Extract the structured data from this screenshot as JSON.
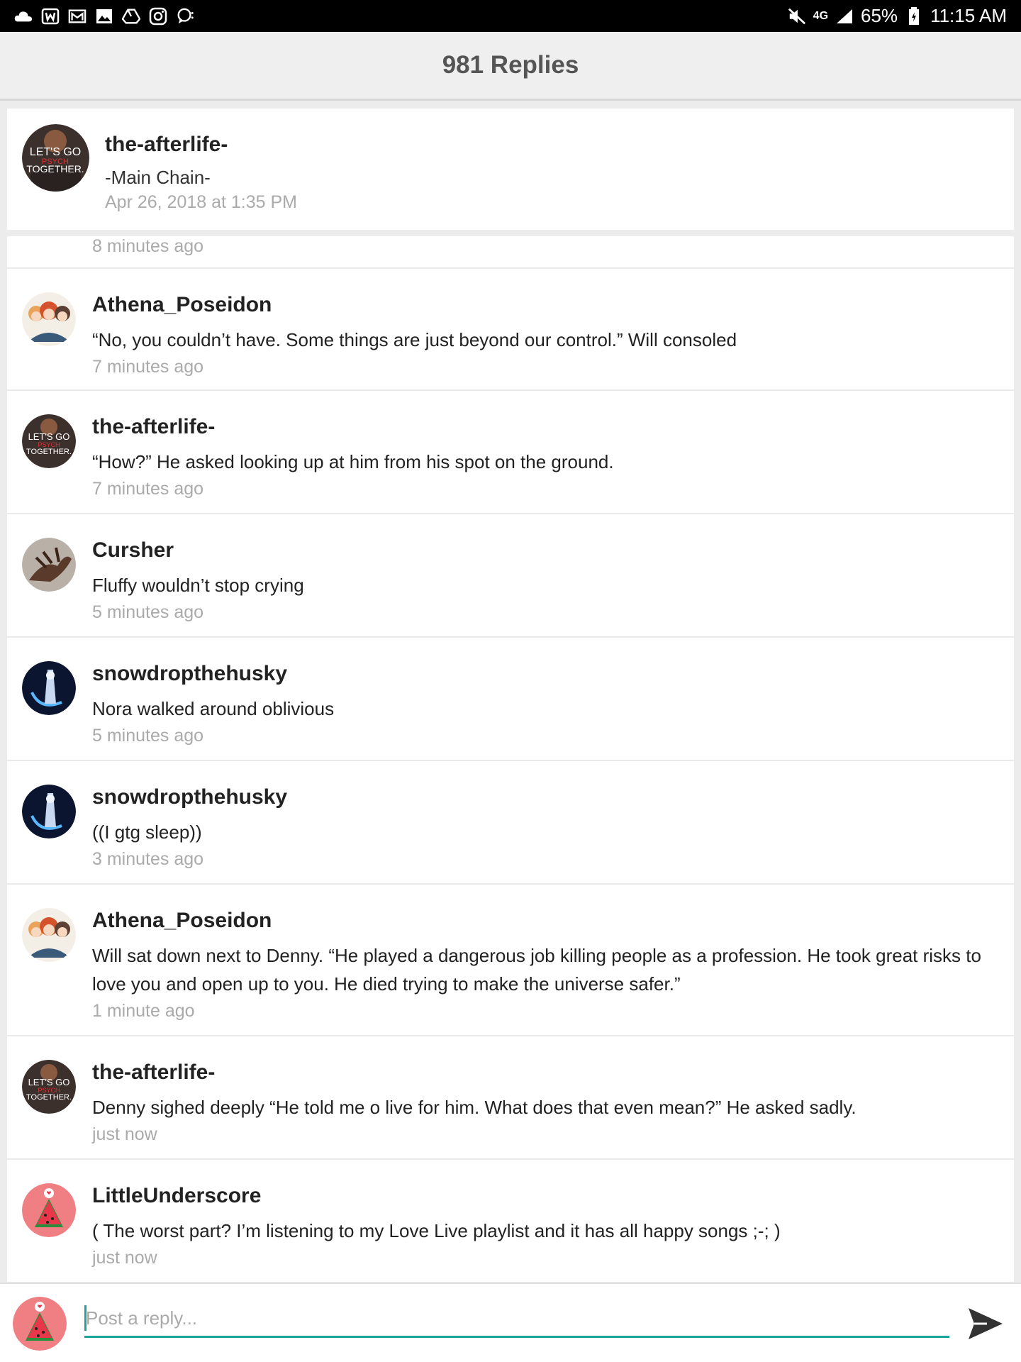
{
  "status_bar": {
    "left_icons": [
      "cloud-icon",
      "wattpad-icon",
      "mail-icon",
      "photo-icon",
      "drive-icon",
      "instagram-icon",
      "chat-icon"
    ],
    "battery": "65%",
    "time": "11:15 AM",
    "network": "4G"
  },
  "header": {
    "title": "981 Replies"
  },
  "main_post": {
    "author": "the-afterlife-",
    "chain": "-Main Chain-",
    "date": "Apr 26, 2018 at 1:35 PM"
  },
  "partial_reply_time": "8 minutes ago",
  "replies": [
    {
      "author": "Athena_Poseidon",
      "body": "“No, you couldn’t have. Some things are just beyond our control.” Will consoled",
      "time": "7 minutes ago",
      "avatar": "anime-group"
    },
    {
      "author": "the-afterlife-",
      "body": "“How?” He asked looking up at him from his spot on the ground.",
      "time": "7 minutes ago",
      "avatar": "lets-go"
    },
    {
      "author": "Cursher",
      "body": "Fluffy wouldn’t stop crying",
      "time": "5 minutes ago",
      "avatar": "creature"
    },
    {
      "author": "snowdropthehusky",
      "body": "Nora walked around oblivious",
      "time": "5 minutes ago",
      "avatar": "blue-dark"
    },
    {
      "author": "snowdropthehusky",
      "body": "((I gtg sleep))",
      "time": "3 minutes ago",
      "avatar": "blue-dark"
    },
    {
      "author": "Athena_Poseidon",
      "body": "Will sat down next to Denny. “He played a dangerous job killing people as a profession. He took great risks to love you and open up to you. He died trying to make the universe safer.”",
      "time": "1 minute ago",
      "avatar": "anime-group"
    },
    {
      "author": "the-afterlife-",
      "body": "Denny sighed deeply “He told me o live for him. What does that even mean?” He asked sadly.",
      "time": "just now",
      "avatar": "lets-go"
    },
    {
      "author": "LittleUnderscore",
      "body": "( The worst part? I’m listening to my Love Live playlist and it has all happy songs ;-; )",
      "time": "just now",
      "avatar": "watermelon"
    }
  ],
  "avatar_text": {
    "line1": "LET'S GO",
    "line2": "PSYCH",
    "line3": "TOGETHER."
  },
  "composer": {
    "placeholder": "Post a reply..."
  },
  "colors": {
    "accent": "#1aa59a",
    "header_bg": "#efefef",
    "muted_text": "#aaaaaa"
  }
}
